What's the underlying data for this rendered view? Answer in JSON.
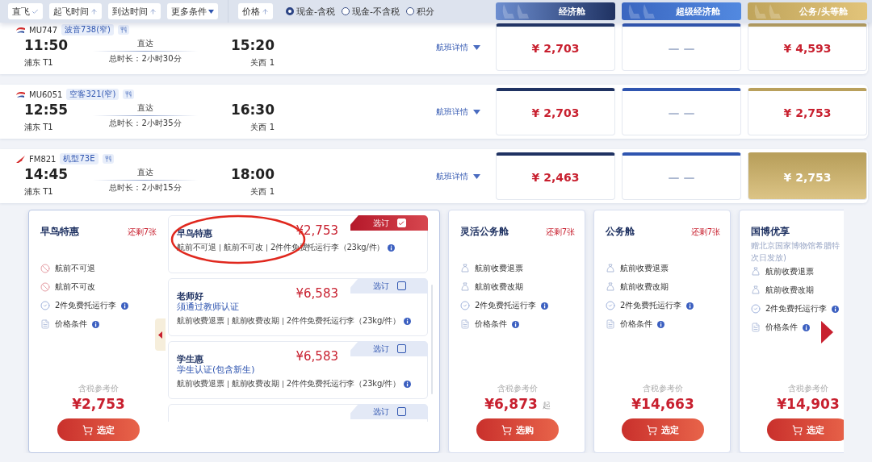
{
  "filters": [
    {
      "label": "直飞",
      "kind": "check"
    },
    {
      "label": "起飞时间",
      "kind": "sort"
    },
    {
      "label": "到达时间",
      "kind": "sort"
    },
    {
      "label": "更多条件",
      "kind": "more"
    }
  ],
  "sort": {
    "label": "价格",
    "kind": "sort"
  },
  "pay_options": [
    {
      "label": "现金-含税",
      "selected": true
    },
    {
      "label": "现金-不含税",
      "selected": false
    },
    {
      "label": "积分",
      "selected": false
    }
  ],
  "cabins": [
    {
      "label": "经济舱",
      "kind": "economy"
    },
    {
      "label": "超级经济舱",
      "kind": "premium"
    },
    {
      "label": "公务/头等舱",
      "kind": "business"
    }
  ],
  "flights": [
    {
      "kind": "eastern",
      "number": "MU747",
      "aircraft": "波音738(窄)",
      "depart": "11:50",
      "depart_terminal": "浦东 T1",
      "route": "直达",
      "duration": "总时长：2小时30分",
      "arrive": "15:20",
      "arrive_terminal": "关西 1",
      "details": "航班详情",
      "prices": [
        {
          "kind": "price",
          "text": "¥ 2,703",
          "selected": false
        },
        {
          "kind": "none",
          "text": "— —",
          "selected": false
        },
        {
          "kind": "price",
          "text": "¥ 4,593",
          "selected": false
        }
      ]
    },
    {
      "kind": "eastern",
      "number": "MU6051",
      "aircraft": "空客321(窄)",
      "depart": "12:55",
      "depart_terminal": "浦东 T1",
      "route": "直达",
      "duration": "总时长：2小时35分",
      "arrive": "16:30",
      "arrive_terminal": "关西 1",
      "details": "航班详情",
      "prices": [
        {
          "kind": "price",
          "text": "¥ 2,703",
          "selected": false
        },
        {
          "kind": "none",
          "text": "— —",
          "selected": false
        },
        {
          "kind": "price",
          "text": "¥ 2,753",
          "selected": false
        }
      ]
    },
    {
      "kind": "shanghai",
      "number": "FM821",
      "aircraft": "机型73E",
      "depart": "14:45",
      "depart_terminal": "浦东 T1",
      "route": "直达",
      "duration": "总时长：2小时15分",
      "arrive": "18:00",
      "arrive_terminal": "关西 1",
      "details": "航班详情",
      "prices": [
        {
          "kind": "price",
          "text": "¥ 2,463",
          "selected": false
        },
        {
          "kind": "none",
          "text": "— —",
          "selected": false
        },
        {
          "kind": "price",
          "text": "¥ 2,753",
          "selected": true
        }
      ]
    }
  ],
  "fare_panel": {
    "annotation": {
      "kind": "ellipse"
    },
    "selected_card": {
      "title": "早鸟特惠",
      "remaining": "还剩7张",
      "features": [
        {
          "kind": "no",
          "text": "航前不可退",
          "info": false
        },
        {
          "kind": "no",
          "text": "航前不可改",
          "info": false
        },
        {
          "kind": "check",
          "text": "2件免费托运行李",
          "info": true
        },
        {
          "kind": "doc",
          "text": "价格条件",
          "info": true
        }
      ],
      "price_label": "含税参考价",
      "price": "¥2,753",
      "button": "选定"
    },
    "options": [
      {
        "title": "早鸟特惠",
        "price": "¥2,753",
        "book": "选订",
        "selected": true,
        "features": [
          "航前不可退",
          "航前不可改",
          "2件件免费托运行李（23kg/件）"
        ]
      },
      {
        "title": "老师好",
        "subtitle": "须通过教师认证",
        "price": "¥6,583",
        "book": "选订",
        "selected": false,
        "features": [
          "航前收费退票",
          "航前收费改期",
          "2件件免费托运行李（23kg/件）"
        ]
      },
      {
        "title": "学生惠",
        "subtitle": "学生认证(包含新生)",
        "price": "¥6,583",
        "book": "选订",
        "selected": false,
        "features": [
          "航前收费退票",
          "航前收费改期",
          "2件件免费托运行李（23kg/件）"
        ]
      },
      {
        "book": "选订",
        "selected": false
      }
    ],
    "cards": [
      {
        "title": "灵活公务舱",
        "remaining": "还剩7张",
        "features": [
          {
            "kind": "fee",
            "text": "航前收费退票",
            "info": false
          },
          {
            "kind": "fee",
            "text": "航前收费改期",
            "info": false
          },
          {
            "kind": "check",
            "text": "2件免费托运行李",
            "info": true
          },
          {
            "kind": "doc",
            "text": "价格条件",
            "info": true
          }
        ],
        "price_label": "含税参考价",
        "price": "¥6,873",
        "price_suffix": "起",
        "button": "选购"
      },
      {
        "title": "公务舱",
        "remaining": "还剩7张",
        "features": [
          {
            "kind": "fee",
            "text": "航前收费退票",
            "info": false
          },
          {
            "kind": "fee",
            "text": "航前收费改期",
            "info": false
          },
          {
            "kind": "check",
            "text": "2件免费托运行李",
            "info": true
          },
          {
            "kind": "doc",
            "text": "价格条件",
            "info": true
          }
        ],
        "price_label": "含税参考价",
        "price": "¥14,663",
        "button": "选定"
      },
      {
        "title": "国博优享",
        "note": [
          "赠北京国家博物馆希腊特",
          "次日发放)"
        ],
        "features": [
          {
            "kind": "fee",
            "text": "航前收费退票",
            "info": false
          },
          {
            "kind": "fee",
            "text": "航前收费改期",
            "info": false
          },
          {
            "kind": "check",
            "text": "2件免费托运行李",
            "info": true
          },
          {
            "kind": "doc",
            "text": "价格条件",
            "info": true
          }
        ],
        "price_label": "含税参考价",
        "price": "¥14,903",
        "button": "选定"
      }
    ]
  }
}
